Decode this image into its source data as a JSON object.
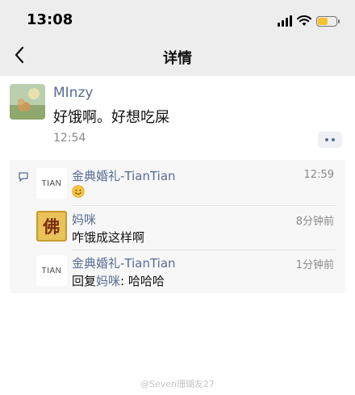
{
  "status_bar": {
    "time": "13:08"
  },
  "nav": {
    "title": "详情"
  },
  "post": {
    "author": "MInzy",
    "text": "好饿啊。好想吃屎",
    "time": "12:54"
  },
  "comments": [
    {
      "author": "金典婚礼-TianTian",
      "avatar_text": "TIAN",
      "time": "12:59",
      "text": ""
    },
    {
      "author": "妈咪",
      "avatar_text": "佛",
      "time": "8分钟前",
      "text": "咋饿成这样啊"
    },
    {
      "author": "金典婚礼-TianTian",
      "avatar_text": "TIAN",
      "time": "1分钟前",
      "reply_prefix": "回复",
      "reply_to": "妈咪",
      "reply_text": ": 哈哈哈"
    }
  ],
  "watermark": "@Seven珊瑚友27",
  "colors": {
    "link": "#576b95",
    "header_bg": "#ededed",
    "comment_bg": "#f7f7f7",
    "battery": "#f4c430"
  }
}
